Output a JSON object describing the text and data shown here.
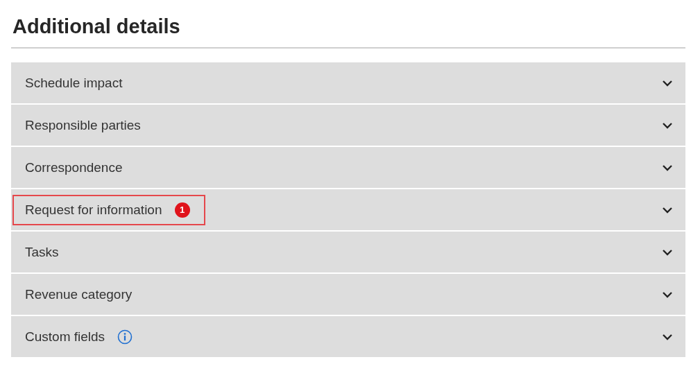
{
  "title": "Additional details",
  "sections": [
    {
      "label": "Schedule impact",
      "expanded": false,
      "highlighted": false
    },
    {
      "label": "Responsible parties",
      "expanded": false,
      "highlighted": false
    },
    {
      "label": "Correspondence",
      "expanded": false,
      "highlighted": false
    },
    {
      "label": "Request for information",
      "expanded": false,
      "highlighted": true,
      "badge": "1"
    },
    {
      "label": "Tasks",
      "expanded": false,
      "highlighted": false
    },
    {
      "label": "Revenue category",
      "expanded": false,
      "highlighted": false
    },
    {
      "label": "Custom fields",
      "expanded": false,
      "highlighted": false,
      "info": true
    }
  ]
}
